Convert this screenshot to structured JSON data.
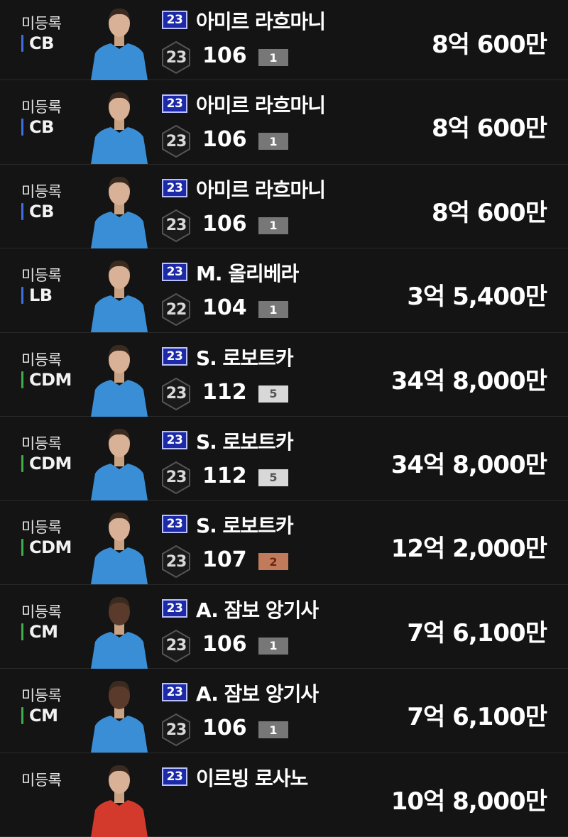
{
  "colors": {
    "background": "#141414",
    "season_badge": "#1c2aa8",
    "pos_defender": "#3f6fe0",
    "pos_midfielder": "#3fae49",
    "grade_gray": "#777777",
    "grade_silver": "#d8d8d8",
    "grade_bronze": "#c27b5a",
    "jersey": "#3a8ed6"
  },
  "rows": [
    {
      "status": "미등록",
      "pos": "CB",
      "pos_group": "defender",
      "season": "23",
      "name": "아미르 라흐마니",
      "hex": "23",
      "ovr": "106",
      "grade": "1",
      "grade_tier": "gray",
      "price": "8억 600만",
      "avatar": "player-portrait-icon"
    },
    {
      "status": "미등록",
      "pos": "CB",
      "pos_group": "defender",
      "season": "23",
      "name": "아미르 라흐마니",
      "hex": "23",
      "ovr": "106",
      "grade": "1",
      "grade_tier": "gray",
      "price": "8억 600만",
      "avatar": "player-portrait-icon"
    },
    {
      "status": "미등록",
      "pos": "CB",
      "pos_group": "defender",
      "season": "23",
      "name": "아미르 라흐마니",
      "hex": "23",
      "ovr": "106",
      "grade": "1",
      "grade_tier": "gray",
      "price": "8억 600만",
      "avatar": "player-portrait-icon"
    },
    {
      "status": "미등록",
      "pos": "LB",
      "pos_group": "defender",
      "season": "23",
      "name": "M. 올리베라",
      "hex": "22",
      "ovr": "104",
      "grade": "1",
      "grade_tier": "gray",
      "price": "3억 5,400만",
      "avatar": "player-portrait-icon"
    },
    {
      "status": "미등록",
      "pos": "CDM",
      "pos_group": "midfielder",
      "season": "23",
      "name": "S. 로보트카",
      "hex": "23",
      "ovr": "112",
      "grade": "5",
      "grade_tier": "silver",
      "price": "34억 8,000만",
      "avatar": "player-portrait-icon"
    },
    {
      "status": "미등록",
      "pos": "CDM",
      "pos_group": "midfielder",
      "season": "23",
      "name": "S. 로보트카",
      "hex": "23",
      "ovr": "112",
      "grade": "5",
      "grade_tier": "silver",
      "price": "34억 8,000만",
      "avatar": "player-portrait-icon"
    },
    {
      "status": "미등록",
      "pos": "CDM",
      "pos_group": "midfielder",
      "season": "23",
      "name": "S. 로보트카",
      "hex": "23",
      "ovr": "107",
      "grade": "2",
      "grade_tier": "bronze",
      "price": "12억 2,000만",
      "avatar": "player-portrait-icon"
    },
    {
      "status": "미등록",
      "pos": "CM",
      "pos_group": "midfielder",
      "season": "23",
      "name": "A. 잠보 앙기사",
      "hex": "23",
      "ovr": "106",
      "grade": "1",
      "grade_tier": "gray",
      "price": "7억 6,100만",
      "avatar": "player-portrait-icon"
    },
    {
      "status": "미등록",
      "pos": "CM",
      "pos_group": "midfielder",
      "season": "23",
      "name": "A. 잠보 앙기사",
      "hex": "23",
      "ovr": "106",
      "grade": "1",
      "grade_tier": "gray",
      "price": "7억 6,100만",
      "avatar": "player-portrait-icon"
    },
    {
      "status": "미등록",
      "pos": "",
      "pos_group": "none",
      "season": "23",
      "name": "이르빙 로사노",
      "hex": "",
      "ovr": "",
      "grade": "",
      "grade_tier": "none",
      "price": "10억 8,000만",
      "avatar": "player-portrait-icon"
    }
  ]
}
